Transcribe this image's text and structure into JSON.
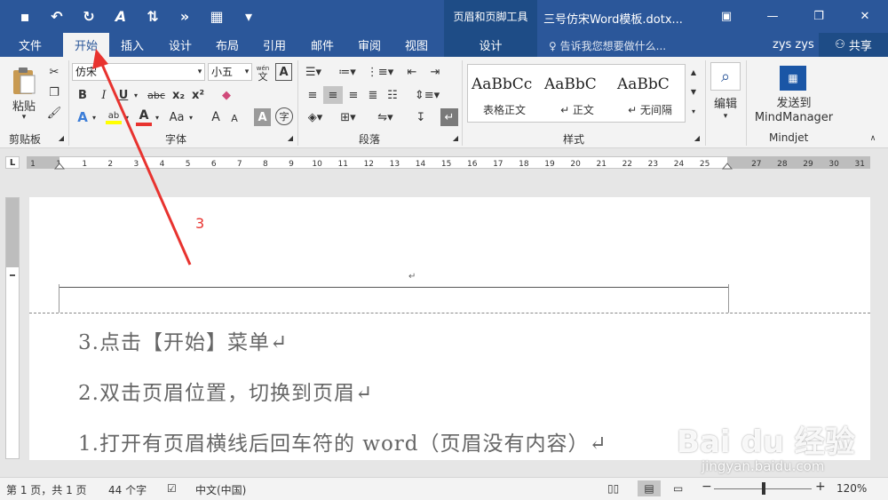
{
  "titlebar": {
    "qat": [
      "save-icon",
      "undo-icon",
      "redo-icon",
      "format-painter-icon",
      "spacing-icon",
      "arrow-icon",
      "table-icon",
      "more-icon"
    ],
    "context_group": "页眉和页脚工具",
    "doc_title": "三号仿宋Word模板.dotx...",
    "window_buttons": [
      "▣",
      "—",
      "❐",
      "✕"
    ]
  },
  "tabs": [
    {
      "label": "文件"
    },
    {
      "label": "开始"
    },
    {
      "label": "插入"
    },
    {
      "label": "设计"
    },
    {
      "label": "布局"
    },
    {
      "label": "引用"
    },
    {
      "label": "邮件"
    },
    {
      "label": "审阅"
    },
    {
      "label": "视图"
    },
    {
      "label": "设计"
    }
  ],
  "tellme": "告诉我您想要做什么...",
  "user": "zys zys",
  "share": "共享",
  "ribbon": {
    "clipboard": {
      "label": "剪贴板",
      "paste": "粘贴"
    },
    "font": {
      "label": "字体",
      "font_name": "仿宋",
      "font_size": "小五",
      "wen": "wén",
      "wen_char": "文",
      "bold": "B",
      "italic": "I",
      "underline": "U",
      "strike": "abc",
      "sub": "x₂",
      "sup": "x²",
      "case": "Aa",
      "grow": "A",
      "shrink": "A",
      "char_a": "A",
      "circle": "字"
    },
    "paragraph": {
      "label": "段落"
    },
    "styles": {
      "label": "样式",
      "items": [
        {
          "sample": "AaBbCc",
          "name": "表格正文"
        },
        {
          "sample": "AaBbC",
          "name": "↵ 正文"
        },
        {
          "sample": "AaBbC",
          "name": "↵ 无间隔"
        }
      ]
    },
    "editing": {
      "label": "编辑"
    },
    "mindjet": {
      "label": "Mindjet",
      "send_line1": "发送到",
      "send_line2": "MindManager"
    }
  },
  "ruler": {
    "ticks": [
      "1",
      "1",
      "1",
      "2",
      "3",
      "4",
      "5",
      "6",
      "7",
      "8",
      "9",
      "10",
      "11",
      "12",
      "13",
      "14",
      "15",
      "16",
      "17",
      "18",
      "19",
      "20",
      "21",
      "22",
      "23",
      "24",
      "25",
      "27",
      "28",
      "29",
      "30",
      "31"
    ],
    "tab_selector": "L"
  },
  "document": {
    "header_mark": "↵",
    "lines": [
      "3.点击【开始】菜单↵",
      "2.双击页眉位置，切换到页眉↵",
      "1.打开有页眉横线后回车符的 word（页眉没有内容）↵"
    ]
  },
  "annotation": {
    "number": "3",
    "color": "#e8332f"
  },
  "watermark": {
    "logo": "Bai du 经验",
    "url": "jingyan.baidu.com"
  },
  "statusbar": {
    "page": "第 1 页，共 1 页",
    "words": "44 个字",
    "language": "中文(中国)",
    "zoom": "120%",
    "zoom_minus": "−",
    "zoom_plus": "+"
  },
  "colors": {
    "brand": "#2b579a",
    "context": "#1e4c86",
    "ribbon": "#f3f3f3"
  }
}
